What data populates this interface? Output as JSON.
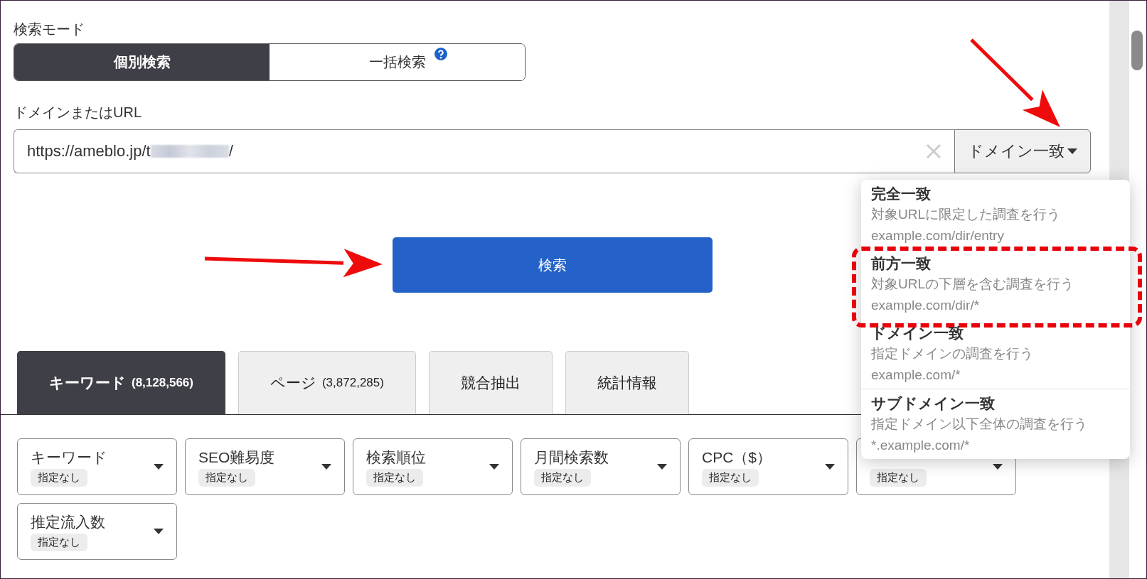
{
  "search_mode": {
    "label": "検索モード",
    "options": [
      {
        "label": "個別検索",
        "selected": true,
        "help": false
      },
      {
        "label": "一括検索",
        "selected": false,
        "help": true
      }
    ]
  },
  "url": {
    "label": "ドメインまたはURL",
    "value_start": "https://ameblo.jp/t",
    "redacted": true,
    "value_end": "/",
    "match_button": "ドメイン一致"
  },
  "match_menu": [
    {
      "title": "完全一致",
      "description": "対象URLに限定した調査を行う",
      "example": "example.com/dir/entry",
      "highlighted": false
    },
    {
      "title": "前方一致",
      "description": "対象URLの下層を含む調査を行う",
      "example": "example.com/dir/*",
      "highlighted": true
    },
    {
      "title": "ドメイン一致",
      "description": "指定ドメインの調査を行う",
      "example": "example.com/*",
      "highlighted": false
    },
    {
      "title": "サブドメイン一致",
      "description": "指定ドメイン以下全体の調査を行う",
      "example": "*.example.com/*",
      "highlighted": false
    }
  ],
  "search_button": "検索",
  "tabs": [
    {
      "label": "キーワード",
      "count": "(8,128,566)",
      "selected": true
    },
    {
      "label": "ページ",
      "count": "(3,872,285)",
      "selected": false
    },
    {
      "label": "競合抽出",
      "selected": false
    },
    {
      "label": "統計情報",
      "selected": false
    }
  ],
  "filters": [
    {
      "label": "キーワード",
      "value": "指定なし"
    },
    {
      "label": "SEO難易度",
      "value": "指定なし"
    },
    {
      "label": "検索順位",
      "value": "指定なし"
    },
    {
      "label": "月間検索数",
      "value": "指定なし"
    },
    {
      "label": "CPC（$）",
      "value": "指定なし"
    },
    {
      "value": "指定なし"
    },
    {
      "label": "推定流入数",
      "value": "指定なし"
    }
  ],
  "annotations": [
    {
      "kind": "arrow"
    },
    {
      "kind": "arrow"
    }
  ]
}
